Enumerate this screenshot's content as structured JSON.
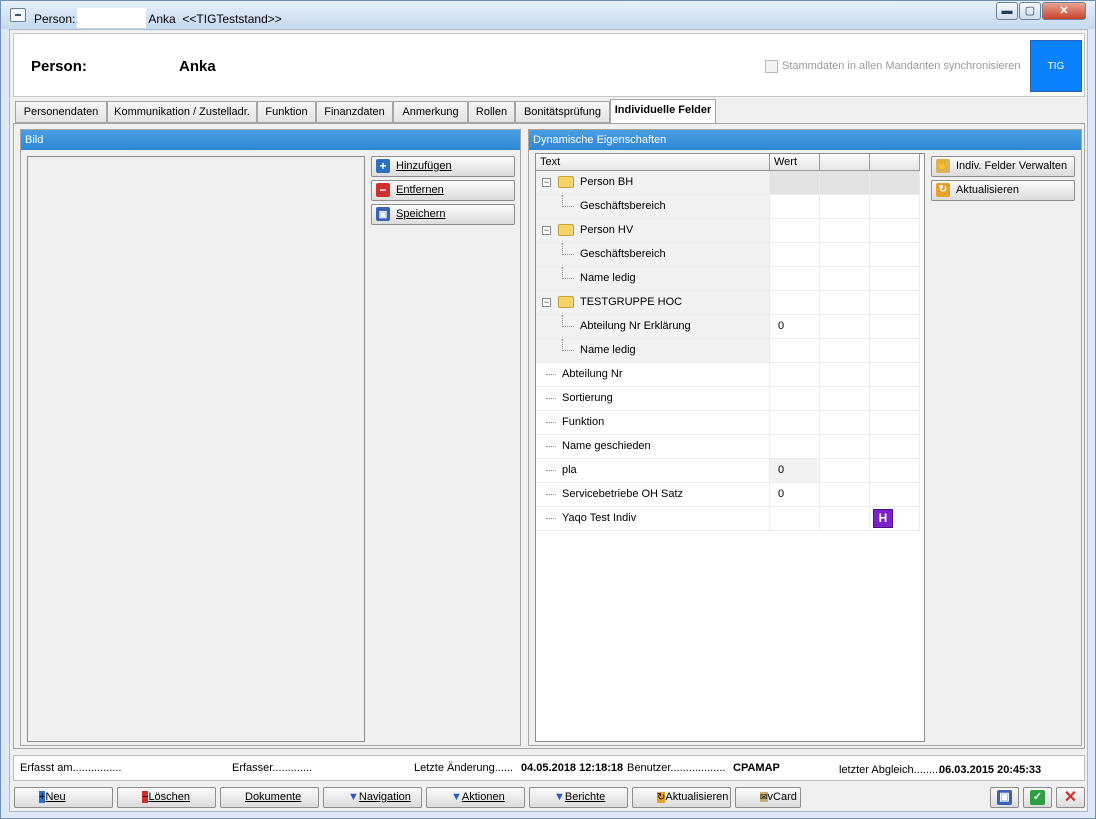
{
  "window": {
    "title_prefix": "Person:",
    "title_name": "Anka",
    "title_suffix": "<<TIGTeststand>>",
    "buttons": [
      "▬",
      "▢",
      "✕"
    ]
  },
  "header": {
    "label": "Person:",
    "name": "Anka",
    "sync_label": "Stammdaten in allen Mandanten synchronisieren",
    "logo_text": "TIG",
    "logo_color": "#0a82ff"
  },
  "tabs": [
    "Personendaten",
    "Kommunikation / Zustelladr.",
    "Funktion",
    "Finanzdaten",
    "Anmerkung",
    "Rollen",
    "Bonitätsprüfung",
    "Individuelle Felder"
  ],
  "bild": {
    "title": "Bild",
    "add_label": "Hinzufügen",
    "remove_label": "Entfernen",
    "save_label": "Speichern"
  },
  "dyn": {
    "title": "Dynamische Eigenschaften",
    "col_text": "Text",
    "col_wert": "Wert",
    "manage_label": "Indiv. Felder Verwalten",
    "refresh_label": "Aktualisieren",
    "rows": [
      {
        "text": "Person BH",
        "value": "",
        "type": "group"
      },
      {
        "text": "Geschäftsbereich",
        "value": "",
        "type": "child"
      },
      {
        "text": "Person HV",
        "value": "",
        "type": "group"
      },
      {
        "text": "Geschäftsbereich",
        "value": "",
        "type": "child"
      },
      {
        "text": "Name ledig",
        "value": "",
        "type": "child"
      },
      {
        "text": "TESTGRUPPE HOC",
        "value": "",
        "type": "group"
      },
      {
        "text": "Abteilung Nr Erklärung",
        "value": "0",
        "type": "child"
      },
      {
        "text": "Name ledig",
        "value": "",
        "type": "child"
      },
      {
        "text": "Abteilung Nr",
        "value": "",
        "type": "leaf"
      },
      {
        "text": "Sortierung",
        "value": "",
        "type": "leaf"
      },
      {
        "text": "Funktion",
        "value": "",
        "type": "leaf"
      },
      {
        "text": "Name geschieden",
        "value": "",
        "type": "leaf"
      },
      {
        "text": "pla",
        "value": "0",
        "type": "leaf"
      },
      {
        "text": "Servicebetriebe OH Satz",
        "value": "0",
        "type": "leaf"
      },
      {
        "text": "Yaqo Test Indiv",
        "value": "",
        "type": "leaf",
        "icon": "H"
      }
    ]
  },
  "status": {
    "erfasst_am": "Erfasst am................",
    "erfasser": "Erfasser.............",
    "letzte_aenderung_label": "Letzte Änderung......",
    "letzte_aenderung_value": "04.05.2018 12:18:18",
    "benutzer_label": "Benutzer..................",
    "benutzer_value": "CPAMAP",
    "abgleich_label": "letzter Abgleich.........",
    "abgleich_value": "06.03.2015 20:45:33"
  },
  "toolbar": {
    "neu": "Neu",
    "loeschen": "Löschen",
    "dokumente": "Dokumente",
    "navigation": "Navigation",
    "aktionen": "Aktionen",
    "berichte": "Berichte",
    "aktualisieren": "Aktualisieren",
    "vcard": "vCard"
  }
}
